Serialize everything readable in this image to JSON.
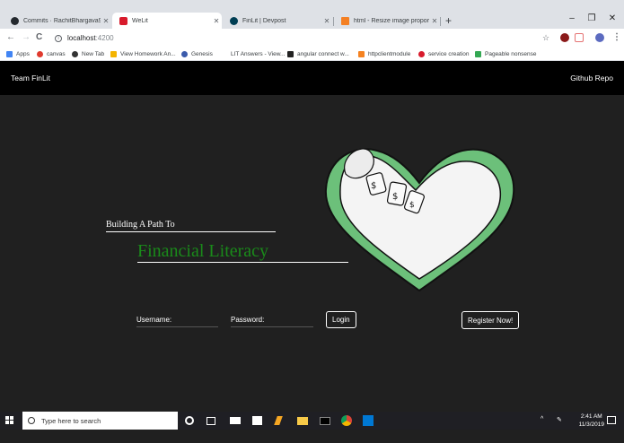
{
  "browser": {
    "tabs": [
      {
        "label": "Commits · RachitBhargava99/He",
        "color": "#24292e"
      },
      {
        "label": "WeLit",
        "color": "#d81b2c"
      },
      {
        "label": "FinLit | Devpost",
        "color": "#003e54"
      },
      {
        "label": "html - Resize image proportiona",
        "color": "#f48024"
      }
    ],
    "new_tab_symbol": "+",
    "window_controls": {
      "minimize": "–",
      "maximize": "❐",
      "close": "✕"
    },
    "nav": {
      "back": "←",
      "forward": "→",
      "reload": "C"
    },
    "address": {
      "host": "localhost",
      "port": ":4200"
    },
    "bookmarks": [
      {
        "label": "Apps",
        "color": "#4285f4"
      },
      {
        "label": "canvas",
        "color": "#e03a2e"
      },
      {
        "label": "New Tab",
        "color": "#333333"
      },
      {
        "label": "View Homework An...",
        "color": "#f4b400"
      },
      {
        "label": "Genesis",
        "color": "#3b5bab"
      },
      {
        "label": "LIT Answers - View...",
        "color": "#ffffff"
      },
      {
        "label": "angular connect w...",
        "color": "#222222"
      },
      {
        "label": "httpclientmodule",
        "color": "#f58220"
      },
      {
        "label": "service creation",
        "color": "#d81b2c"
      },
      {
        "label": "Pageable nonsense",
        "color": "#34a853"
      }
    ]
  },
  "app": {
    "brand": "Team FinLit",
    "github_link": "Github Repo",
    "tagline": "Building A Path To",
    "headline": "Financial Literacy",
    "username_label": "Username:",
    "password_label": "Password:",
    "login_label": "Login",
    "register_label": "Register Now!",
    "colors": {
      "headline": "#1a8a1a",
      "heart": "#6cc07a",
      "nav_bg": "#000000",
      "page_bg": "#202020"
    }
  },
  "taskbar": {
    "search_placeholder": "Type here to search",
    "time": "2:41 AM",
    "date": "11/3/2019",
    "tray_chevron": "^"
  }
}
